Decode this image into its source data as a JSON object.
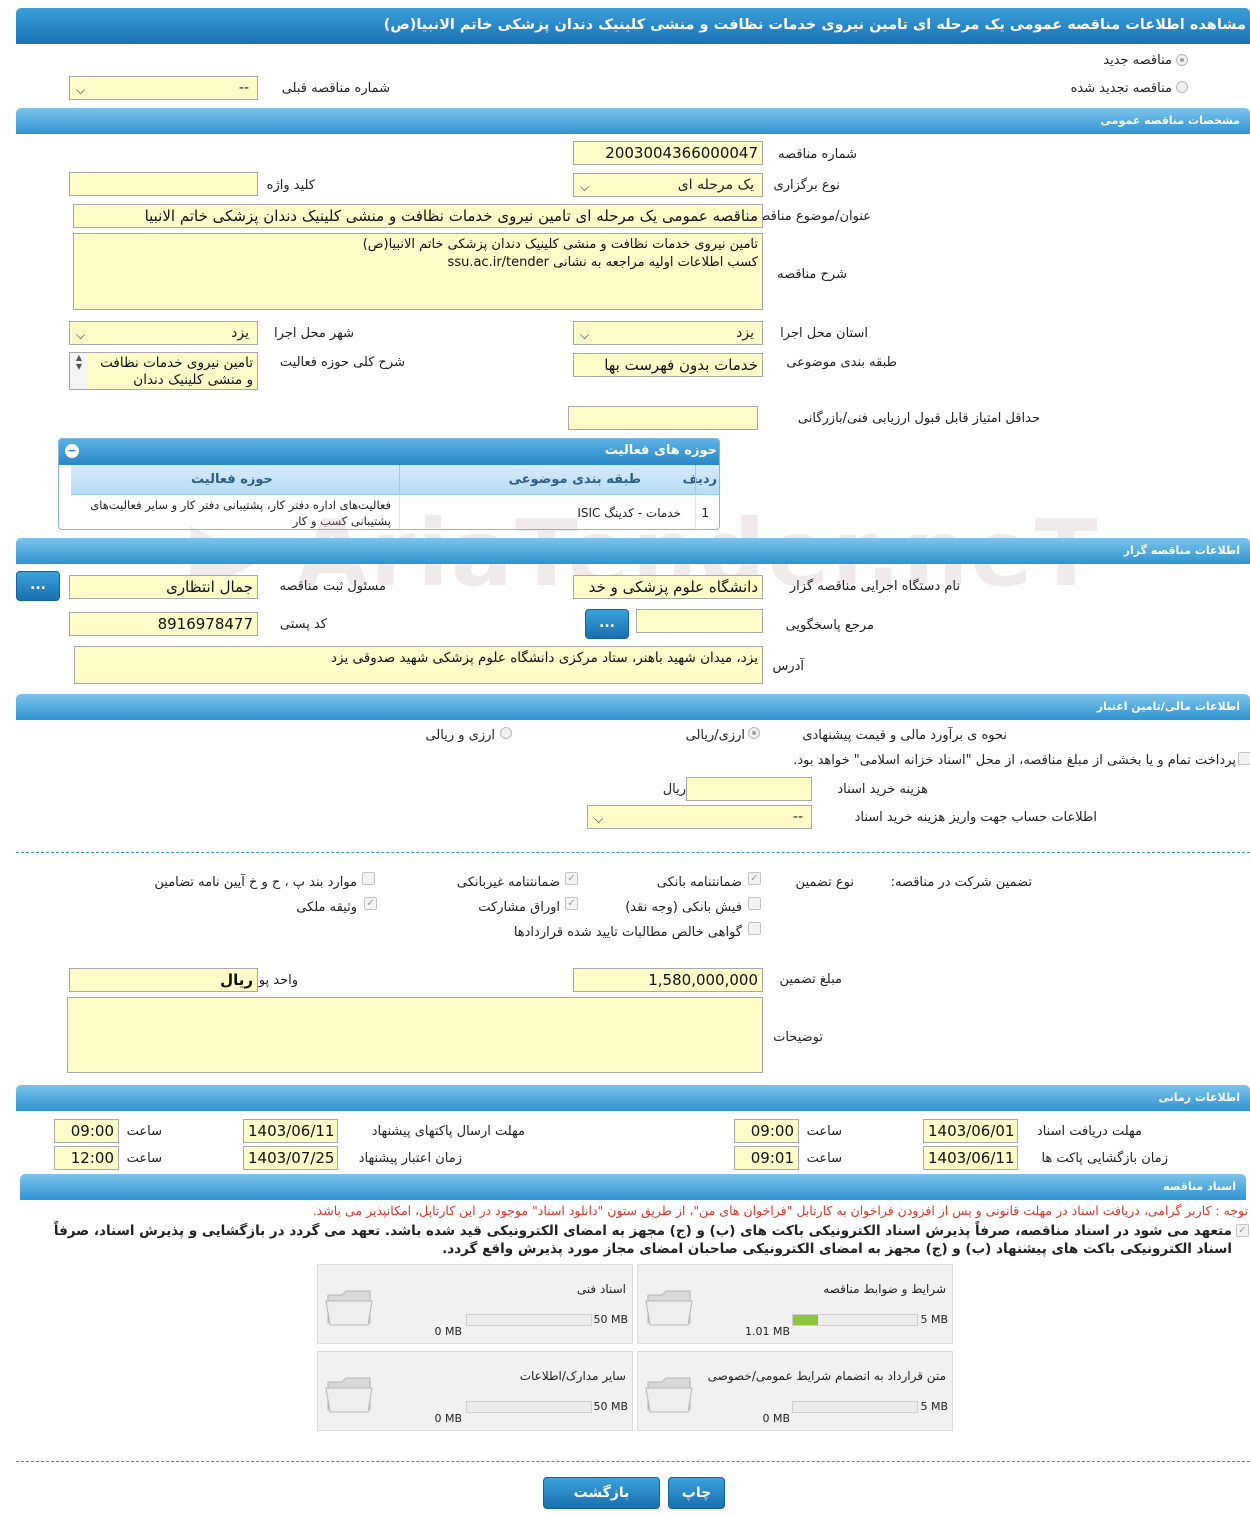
{
  "page_title": "مشاهده اطلاعات مناقصه عمومی یک مرحله ای تامین نیروی خدمات نظافت و منشی کلینیک دندان پزشکی خاتم الانبیا(ص)",
  "top": {
    "new_tender": "مناقصه جدید",
    "renewed_tender": "مناقصه تجدید شده",
    "prev_number_label": "شماره مناقصه قبلی",
    "prev_number_value": "--"
  },
  "general": {
    "header": "مشخصات مناقصه عمومی",
    "number_label": "شماره مناقصه",
    "number_value": "2003004366000047",
    "type_label": "نوع برگزاری",
    "type_value": "یک مرحله ای",
    "keyword_label": "کلید واژه",
    "keyword_value": "",
    "subject_label": "عنوان/موضوع مناقصه",
    "subject_value": "مناقصه عمومی یک مرحله ای تامین نیروی خدمات نظافت و منشی کلینیک دندان پزشکی خاتم الانبیا",
    "desc_label": "شرح مناقصه",
    "desc_value": "تامین نیروی خدمات نظافت و منشی کلینیک دندان پزشکی خاتم الانبیا(ص)\nکسب اطلاعات اولیه مراجعه به نشانی ssu.ac.ir/tender",
    "province_label": "استان محل اجرا",
    "province_value": "یزد",
    "city_label": "شهر محل اجرا",
    "city_value": "یزد",
    "category_label": "طبقه بندی موضوعی",
    "category_value": "خدمات بدون فهرست بها",
    "activity_desc_label": "شرح کلی حوزه فعالیت",
    "activity_desc_value": "تامین نیروی خدمات نظافت و منشی کلینیک دندان",
    "min_score_label": "حداقل امتیاز قابل قبول ارزیابی فنی/بازرگانی",
    "min_score_value": ""
  },
  "activities": {
    "header": "حوزه های فعالیت",
    "columns": [
      "ردیف",
      "طبقه بندی موضوعی",
      "حوزه فعالیت"
    ],
    "rows": [
      {
        "idx": "1",
        "category": "خدمات - کدینگ ISIC",
        "field": "فعالیت‌های  اداره دفتر کار، پشتیبانی دفتر کار و سایر فعالیت‌های پشتیبانی کسب و کار"
      }
    ]
  },
  "watermark": "AriaTender.neT",
  "organizer": {
    "header": "اطلاعات مناقصه گزار",
    "org_label": "نام دستگاه اجرایی مناقصه گزار",
    "org_value": "دانشگاه علوم پزشکی و خد",
    "registrar_label": "مسئول ثبت مناقصه",
    "registrar_value": "جمال انتظاری",
    "dots": "...",
    "ref_label": "مرجع پاسخگویی",
    "ref_value": "",
    "postal_label": "کد پستی",
    "postal_value": "8916978477",
    "address_label": "آدرس",
    "address_value": "یزد، میدان شهید باهنر، ستاد مرکزی دانشگاه علوم پزشکی شهید صدوقی یزد"
  },
  "finance": {
    "header": "اطلاعات مالی/تامین اعتبار",
    "method_label": "نحوه ی برآورد مالی و قیمت پیشنهادی",
    "opt_rial": "ارزی/ریالی",
    "opt_fx": "ارزی و ریالی",
    "treasury_text": "پرداخت تمام و یا بخشی از مبلغ مناقصه، از محل \"اسناد خزانه اسلامی\" خواهد بود.",
    "doc_cost_label": "هزینه خرید اسناد",
    "doc_cost_value": "",
    "doc_cost_unit": "ریال",
    "account_label": "اطلاعات حساب جهت واریز هزینه خرید اسناد",
    "account_value": "--"
  },
  "guarantee": {
    "label": "تضمین شرکت در مناقصه:",
    "type_label": "نوع تضمین",
    "items": {
      "bank_guarantee": "ضمانتنامه بانکی",
      "nonbank_guarantee": "ضمانتنامه غیربانکی",
      "cases": "موارد بند پ ، ح و خ آیین نامه تضامین",
      "bank_receipt": "فیش بانکی (وجه نقد)",
      "bonds": "اوراق مشارکت",
      "property": "وثیقه ملکی",
      "receivables": "گواهی خالص مطالبات تایید شده قراردادها"
    },
    "amount_label": "مبلغ تضمین",
    "amount_value": "1,580,000,000",
    "currency_label": "واحد پول",
    "currency_value": "ریال",
    "notes_label": "توضیحات",
    "notes_value": ""
  },
  "timing": {
    "header": "اطلاعات زمانی",
    "doc_deadline_label": "مهلت دریافت اسناد",
    "doc_deadline_date": "1403/06/01",
    "doc_deadline_time": "09:00",
    "send_deadline_label": "مهلت ارسال پاکتهای پیشنهاد",
    "send_deadline_date": "1403/06/11",
    "send_deadline_time": "09:00",
    "open_label": "زمان بازگشایی پاکت ها",
    "open_date": "1403/06/11",
    "open_time": "09:01",
    "validity_label": "زمان اعتبار پیشنهاد",
    "validity_date": "1403/07/25",
    "validity_time": "12:00",
    "time_label": "ساعت"
  },
  "documents": {
    "header": "اسناد مناقصه",
    "note": "توجه : کاربر گرامی، دریافت اسناد در مهلت قانونی و پس از افزودن فراخوان به کارتابل \"فراخوان های من\"، از طریق ستون \"دانلود اسناد\" موجود در این کارتابل، امکانپذیر می باشد.",
    "commit": "متعهد می شود در اسناد مناقصه، صرفاً پذیرش اسناد الکترونیکی باکت های (ب) و (ج) مجهز به امضای الکترونیکی قید شده باشد. تعهد می گردد در بازگشایی و پذیرش اسناد، صرفاً اسناد الکترونیکی باکت های پیشنهاد (ب) و (ج) مجهز به امضای الکترونیکی صاحبان امضای مجاز مورد پذیرش واقع گردد.",
    "files": [
      {
        "title": "شرایط و ضوابط مناقصه",
        "current": "1.01 MB",
        "max": "5 MB",
        "fill": 0.2
      },
      {
        "title": "اسناد فنی",
        "current": "0 MB",
        "max": "50 MB",
        "fill": 0
      },
      {
        "title": "متن قرارداد به انضمام شرایط عمومی/خصوصی",
        "current": "0 MB",
        "max": "5 MB",
        "fill": 0
      },
      {
        "title": "سایر مدارک/اطلاعات",
        "current": "0 MB",
        "max": "50 MB",
        "fill": 0
      }
    ]
  },
  "buttons": {
    "back": "بازگشت",
    "print": "چاپ"
  }
}
